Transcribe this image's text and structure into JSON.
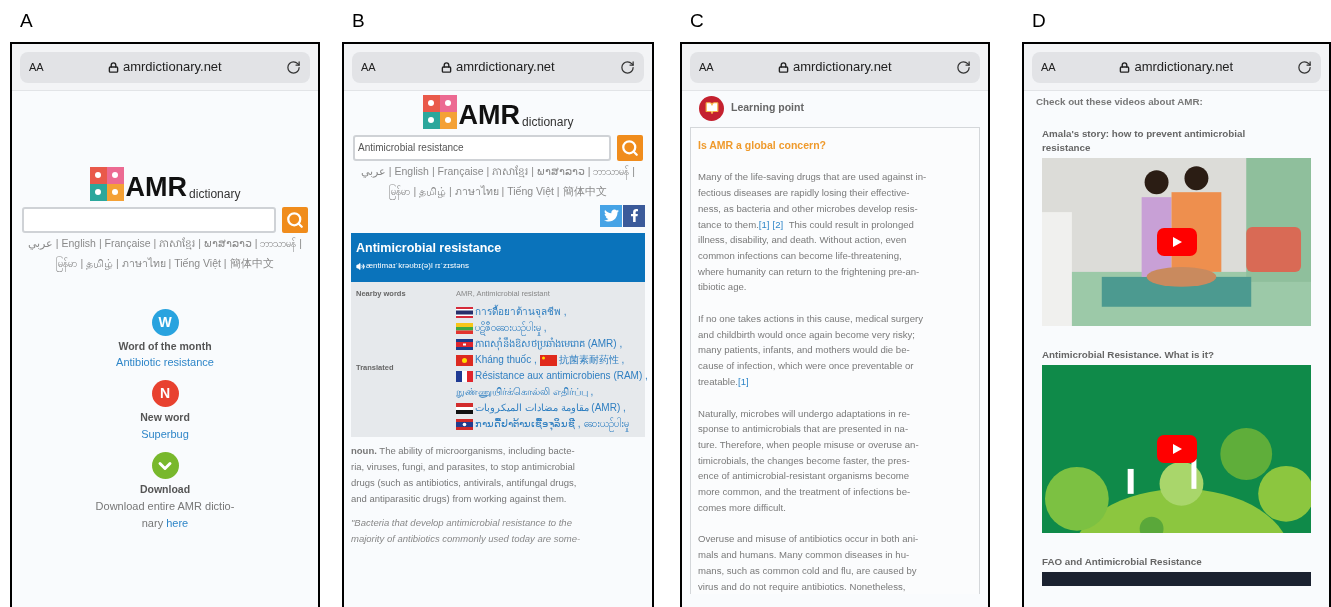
{
  "panels": [
    {
      "label": "A",
      "kind": "home",
      "browser": {
        "text_size": "AA",
        "url": "amrdictionary.net"
      },
      "logo": {
        "main": "AMR",
        "sub": "dictionary"
      },
      "separator": "|",
      "languages": [
        "عربي",
        "English",
        "Française",
        "ភាសាខ្មែរ",
        "ພາສາລາວ",
        "ဘာသာမန်",
        "မြန်မာ",
        "தமிழ்",
        "ภาษาไทย",
        "Tiếng Việt",
        "簡体中文"
      ],
      "features": [
        {
          "kind": "letter",
          "badge": "W",
          "color": "#29a3df",
          "title": "Word of the month",
          "link": "Antibiotic resistance"
        },
        {
          "kind": "letter",
          "badge": "N",
          "color": "#e8412f",
          "title": "New word",
          "link": "Superbug"
        },
        {
          "kind": "check",
          "color": "#78b82c",
          "title": "Download",
          "text": "Download entire AMR dictio-\nnary",
          "link": "here"
        }
      ]
    },
    {
      "label": "B",
      "kind": "entry",
      "browser": {
        "text_size": "AA",
        "url": "amrdictionary.net"
      },
      "logo": {
        "main": "AMR",
        "sub": "dictionary"
      },
      "search": {
        "value": "Antimicrobial resistance"
      },
      "separator": "|",
      "languages": [
        "عربي",
        "English",
        "Française",
        "ភាសាខ្មែរ",
        "ພາສາລາວ",
        "ဘာသာမန်",
        "မြန်မာ",
        "தமிழ்",
        "ภาษาไทย",
        "Tiếng Việt",
        "簡体中文"
      ],
      "headword": "Antimicrobial resistance",
      "pronunciation": "æntimaɪˈkrəʊbɪ(ə)l rɪˈzɪstəns",
      "rows": [
        {
          "kind": "text",
          "label": "Nearby words",
          "value": "AMR, Antimicrobial resistant"
        },
        {
          "kind": "translations",
          "label": "Translated",
          "items": [
            {
              "kind": "thailand",
              "text": "การดื้อยาต้านจุลชีพ ,"
            },
            {
              "kind": "myanmar",
              "text": "ပဋိဇီဝဆေးယဉ်ပါးမှု ,"
            },
            {
              "kind": "cambodia",
              "text": "ភាពស៊ាំនឹងឱសថប្រឆាំងមេរោគ (AMR) ,"
            },
            {
              "kind": "vietnam",
              "text": "Kháng thuốc ,"
            },
            {
              "kind": "china",
              "text": "抗菌素耐药性 ,"
            },
            {
              "kind": "france",
              "text": "Résistance aux antimicrobiens (RAM) ,"
            },
            {
              "kind": "plain",
              "text": "நுண்ணுயிர்க்கொல்லி எதிர்ப்பு ,"
            },
            {
              "kind": "iraq",
              "text": "مقاومة مضادات الميكروبات (AMR) ,"
            },
            {
              "kind": "laos",
              "text": "ການດື້ຢາຕ້ານເຊື້ອຈຸລິນຊີ ,"
            },
            {
              "kind": "plain",
              "text": "ဆေးယဉ်ပါးမှု"
            }
          ]
        }
      ],
      "definition": "**noun.** The ability of microorganisms, including bacte-\nria, viruses, fungi, and parasites, to stop antimicrobial\ndrugs (such as antibiotics, antivirals, antifungal drugs,\nand antiparasitic drugs) from working against them.",
      "quote": "\"Bacteria that develop antimicrobial resistance to the\nmajority of antibiotics commonly used today are some-"
    },
    {
      "label": "C",
      "kind": "article",
      "browser": {
        "text_size": "AA",
        "url": "amrdictionary.net"
      },
      "section": "Learning point",
      "title": "Is AMR a global concern?",
      "paragraphs": [
        [
          {
            "kind": "text",
            "text": "Many of the life-saving drugs that are used against in-\nfectious diseases are rapidly losing their effective-\nness, as bacteria and other microbes develop resis-\ntance to them."
          },
          {
            "kind": "ref",
            "text": "[1]"
          },
          {
            "kind": "ref",
            "text": "[2]"
          },
          {
            "kind": "text",
            "text": " This could result in prolonged\nillness, disability, and death. Without action, even\ncommon infections can become life-threatening,\nwhere humanity can return to the frightening pre-an-\ntibiotic age."
          }
        ],
        [
          {
            "kind": "text",
            "text": "If no one takes actions in this cause, medical surgery\nand childbirth would once again become very risky;\nmany patients, infants, and mothers would die be-\ncause of infection, which were once preventable or\ntreatable."
          },
          {
            "kind": "ref",
            "text": "[1]"
          }
        ],
        [
          {
            "kind": "text",
            "text": "Naturally, microbes will undergo adaptations in re-\nsponse to antimicrobials that are presented in na-\nture. Therefore, when people misuse or overuse an-\ntimicrobials, the changes become faster, the pres-\nence of antimicrobial-resistant organisms become\nmore common, and the treatment of infections be-\ncomes more difficult."
          }
        ],
        [
          {
            "kind": "text",
            "text": "Overuse and misuse of antibiotics occur in both ani-\nmals and humans. Many common diseases in hu-\nmans, such as common cold and flu, are caused by\nvirus and do not require antibiotics. Nonetheless,"
          }
        ]
      ]
    },
    {
      "label": "D",
      "kind": "videos",
      "browser": {
        "text_size": "AA",
        "url": "amrdictionary.net"
      },
      "heading": "Check out these videos about AMR:",
      "videos": [
        {
          "title": "Amala's story: how to prevent antimicrobial resistance",
          "kind": "picture"
        },
        {
          "title": "Antimicrobial Resistance. What is it?",
          "kind": "picture"
        },
        {
          "title": "FAO and Antimicrobial Resistance",
          "kind": "picture"
        }
      ]
    }
  ]
}
